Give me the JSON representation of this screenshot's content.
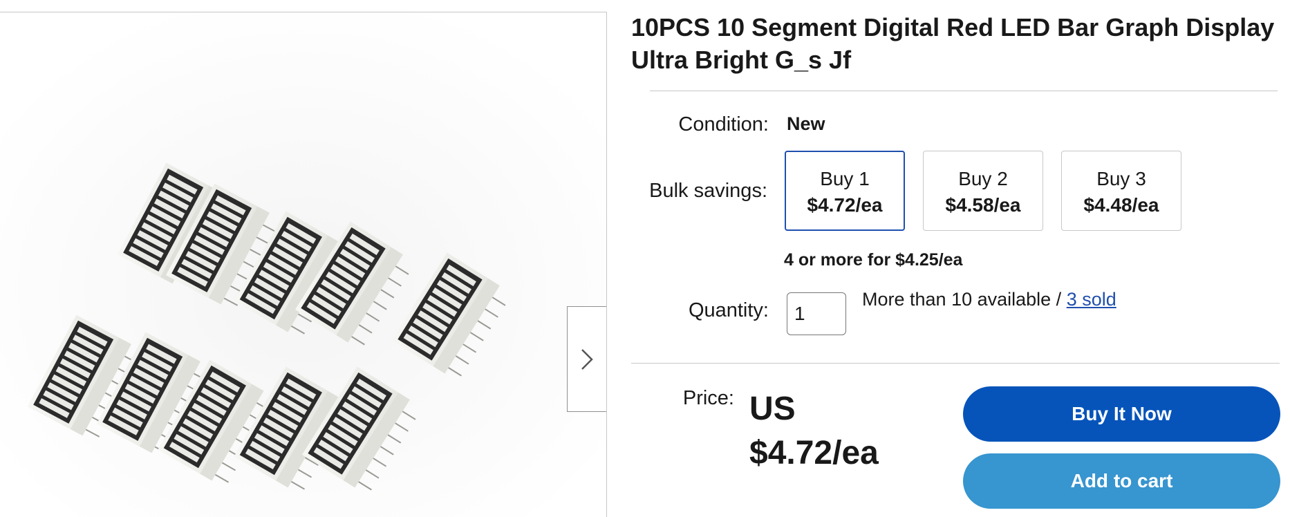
{
  "listing": {
    "title": "10PCS 10 Segment Digital Red LED Bar Graph Display Ultra Bright G_s Jf"
  },
  "gallery": {
    "image_alt": "10 white LED bar graph display modules with 10 dark segments each",
    "next_icon": "chevron-right-icon"
  },
  "condition": {
    "label": "Condition:",
    "value": "New"
  },
  "bulk": {
    "label": "Bulk savings:",
    "options": [
      {
        "qty": "Buy 1",
        "price": "$4.72/ea",
        "selected": true
      },
      {
        "qty": "Buy 2",
        "price": "$4.58/ea",
        "selected": false
      },
      {
        "qty": "Buy 3",
        "price": "$4.48/ea",
        "selected": false
      }
    ],
    "more": "4 or more for $4.25/ea"
  },
  "quantity": {
    "label": "Quantity:",
    "value": "1",
    "available": "More than 10 available /",
    "sold_link": "3 sold"
  },
  "price": {
    "label": "Price:",
    "currency": "US",
    "value": "$4.72/ea"
  },
  "actions": {
    "buy_now": "Buy It Now",
    "add_to_cart": "Add to cart"
  },
  "colors": {
    "primary_button": "#0654ba",
    "secondary_button": "#3795cf",
    "link": "#1f4fae",
    "selected_border": "#1f4fae"
  }
}
